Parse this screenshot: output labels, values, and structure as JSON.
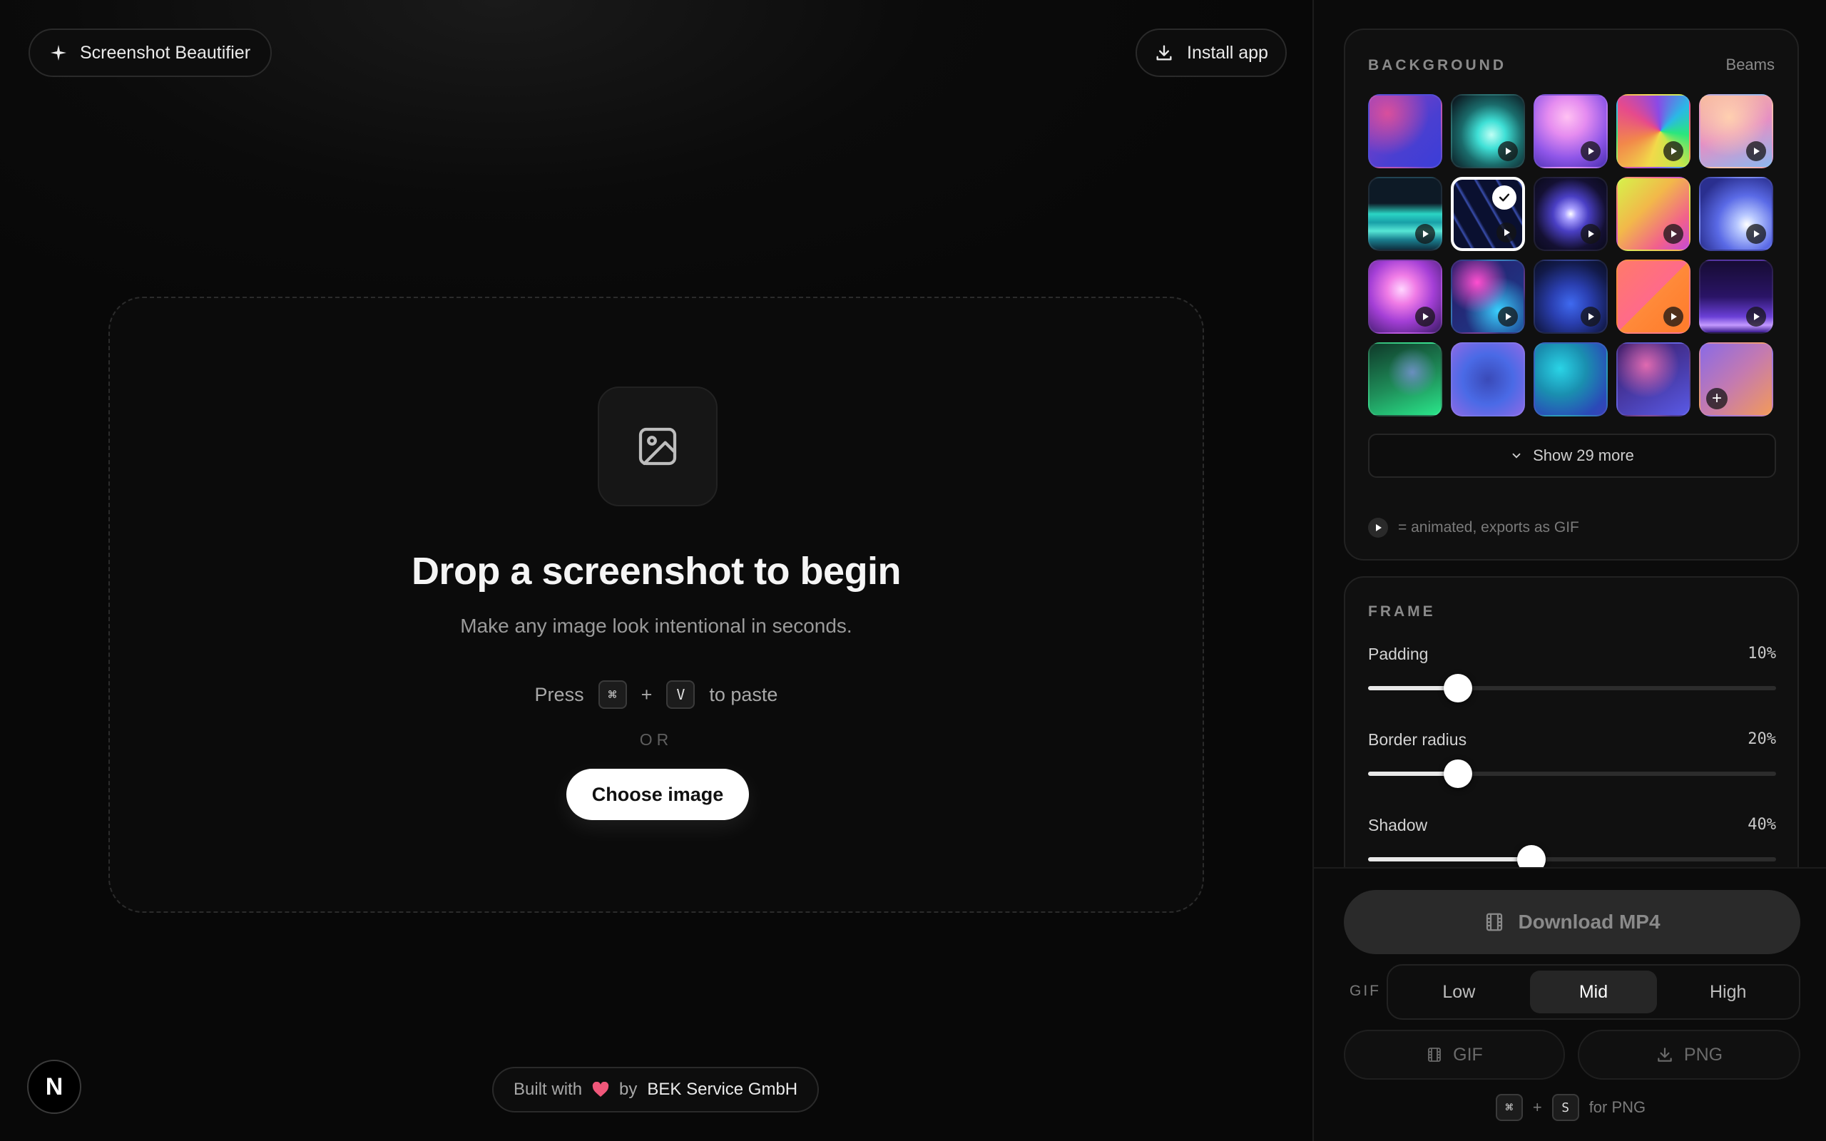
{
  "header": {
    "brand_label": "Screenshot Beautifier",
    "install_label": "Install app"
  },
  "dropzone": {
    "title": "Drop a screenshot to begin",
    "subtitle": "Make any image look intentional in seconds.",
    "press_label": "Press",
    "key_cmd": "⌘",
    "plus": "+",
    "key_v": "V",
    "paste_suffix": "to paste",
    "or_label": "OR",
    "choose_label": "Choose image"
  },
  "footer": {
    "built_with": "Built with",
    "by": "by",
    "company": "BEK Service GmbH",
    "avatar_letter": "N"
  },
  "background": {
    "label": "BACKGROUND",
    "current": "Beams",
    "show_more_label": "Show 29 more",
    "legend_text": "= animated, exports as GIF",
    "swatches": [
      {
        "name": "violet-blur",
        "animated": false,
        "selected": false
      },
      {
        "name": "teal-glow",
        "animated": true,
        "selected": false
      },
      {
        "name": "pink-orb",
        "animated": true,
        "selected": false
      },
      {
        "name": "conic-rainbow",
        "animated": true,
        "selected": false
      },
      {
        "name": "peach-sky",
        "animated": true,
        "selected": false
      },
      {
        "name": "waves",
        "animated": true,
        "selected": false
      },
      {
        "name": "beams",
        "animated": true,
        "selected": true
      },
      {
        "name": "spotlight",
        "animated": true,
        "selected": false
      },
      {
        "name": "lime-pink",
        "animated": true,
        "selected": false
      },
      {
        "name": "blue-flare",
        "animated": true,
        "selected": false
      },
      {
        "name": "magenta-orb",
        "animated": true,
        "selected": false
      },
      {
        "name": "neon-mix",
        "animated": true,
        "selected": false
      },
      {
        "name": "deep-blue",
        "animated": true,
        "selected": false
      },
      {
        "name": "split-coral",
        "animated": true,
        "selected": false
      },
      {
        "name": "purple-horizon",
        "animated": true,
        "selected": false
      },
      {
        "name": "emerald",
        "animated": false,
        "selected": false
      },
      {
        "name": "indigo-soft",
        "animated": false,
        "selected": false
      },
      {
        "name": "cyan-deep",
        "animated": false,
        "selected": false
      },
      {
        "name": "rose-indigo",
        "animated": false,
        "selected": false
      },
      {
        "name": "custom-gradient",
        "animated": false,
        "selected": false,
        "custom": true
      }
    ]
  },
  "frame": {
    "label": "FRAME",
    "padding": {
      "label": "Padding",
      "value_text": "10%",
      "value": 0.22
    },
    "radius": {
      "label": "Border radius",
      "value_text": "20%",
      "value": 0.22
    },
    "shadow": {
      "label": "Shadow",
      "value_text": "40%",
      "value": 0.4
    }
  },
  "export": {
    "download_label": "Download MP4",
    "gif_label": "GIF",
    "quality_options": [
      "Low",
      "Mid",
      "High"
    ],
    "quality_selected": "Mid",
    "gif_button": "GIF",
    "png_button": "PNG",
    "hint_key_cmd": "⌘",
    "hint_plus": "+",
    "hint_key_s": "S",
    "hint_suffix": "for PNG"
  }
}
